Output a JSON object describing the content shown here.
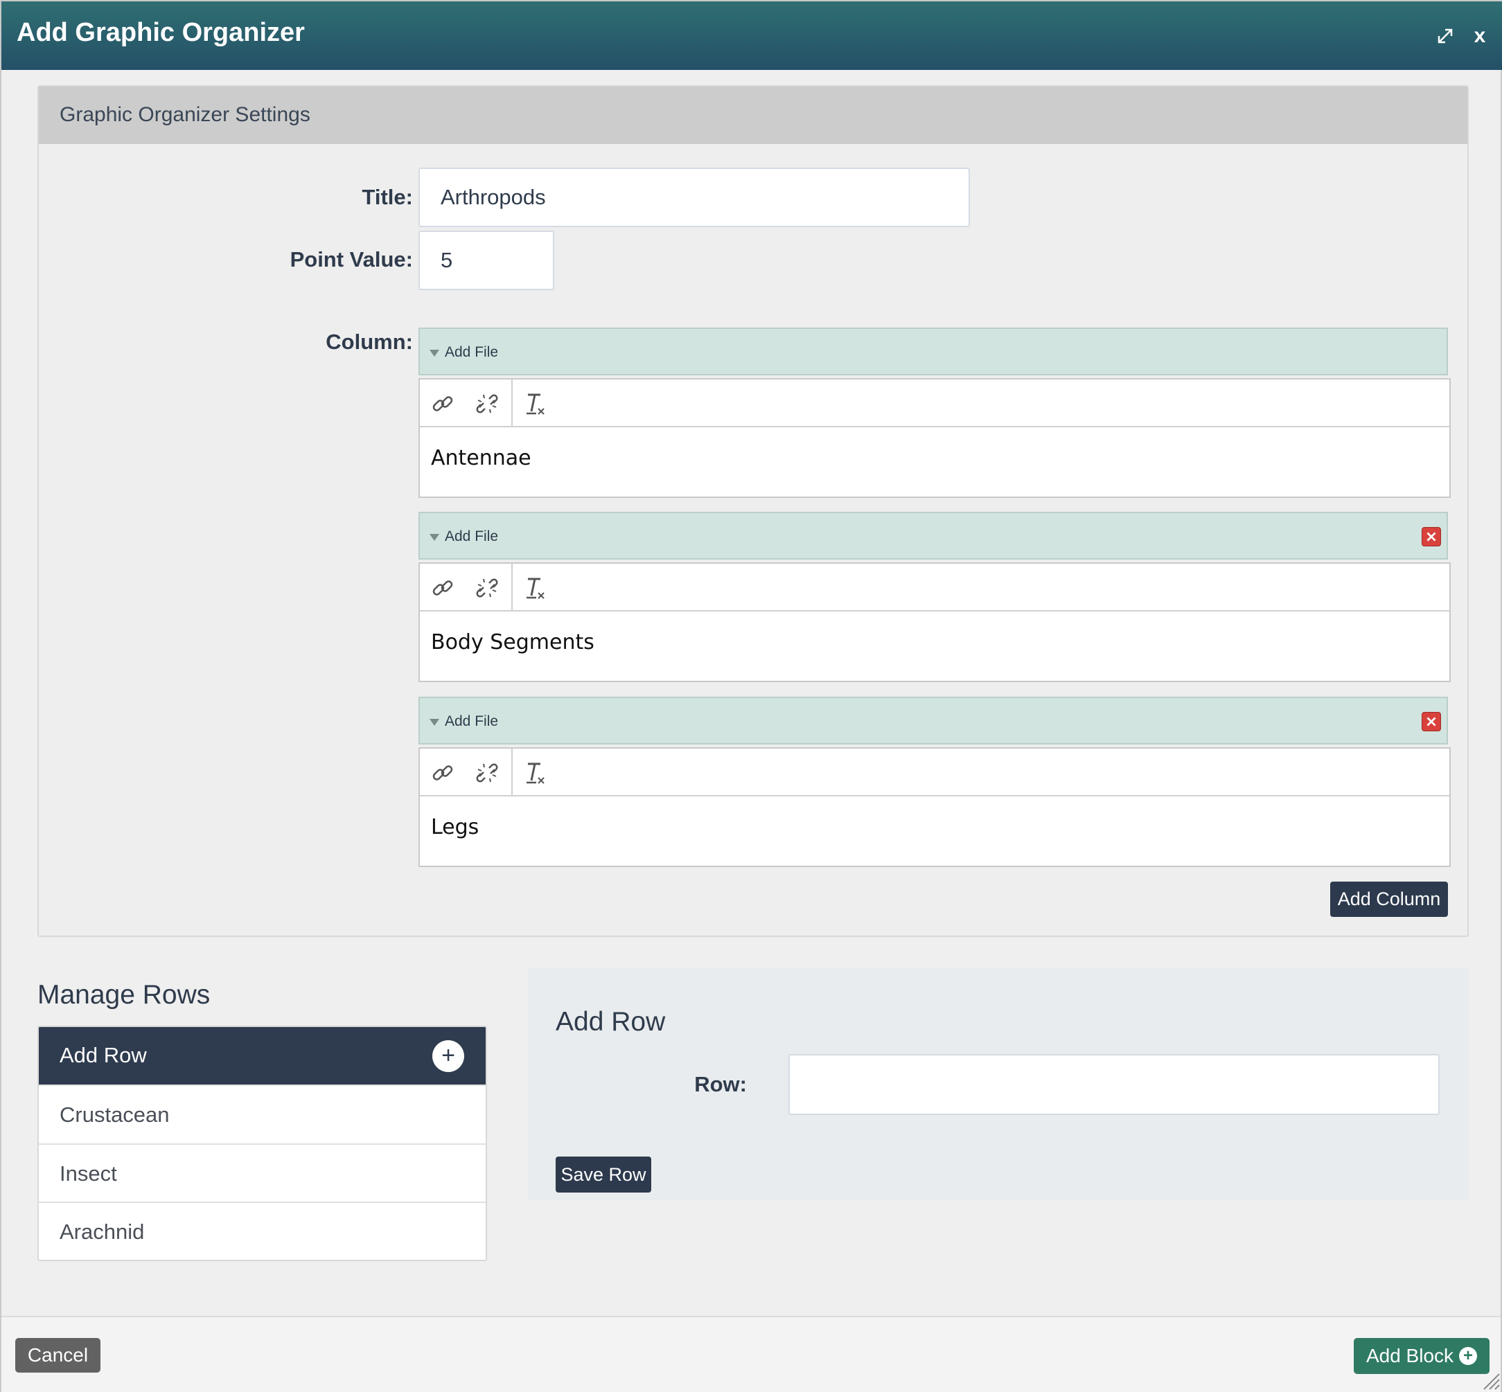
{
  "dialog": {
    "title": "Add Graphic Organizer",
    "expand_icon": "expand-icon",
    "close_label": "x"
  },
  "settings": {
    "header": "Graphic Organizer Settings",
    "title_label": "Title:",
    "title_value": "Arthropods",
    "point_label": "Point Value:",
    "point_value": "5",
    "column_label": "Column:",
    "columns": [
      {
        "add_file": "Add File",
        "text": "Antennae",
        "deletable": false
      },
      {
        "add_file": "Add File",
        "text": "Body Segments",
        "deletable": true
      },
      {
        "add_file": "Add File",
        "text": "Legs",
        "deletable": true
      }
    ],
    "toolbar_icons": [
      "link-icon",
      "unlink-icon",
      "remove-format-icon"
    ],
    "add_column_label": "Add Column"
  },
  "manage_rows": {
    "title": "Manage Rows",
    "add_row_label": "Add Row",
    "rows": [
      "Crustacean",
      "Insect",
      "Arachnid"
    ]
  },
  "add_row_panel": {
    "title": "Add Row",
    "row_label": "Row:",
    "row_value": "",
    "save_label": "Save Row"
  },
  "footer": {
    "cancel_label": "Cancel",
    "add_block_label": "Add Block"
  },
  "colors": {
    "titlebar": "#2a5f6c",
    "dark_button": "#2d3a4d",
    "add_block": "#2f7a63",
    "column_bar": "#d2e4df",
    "delete": "#d9413c"
  }
}
